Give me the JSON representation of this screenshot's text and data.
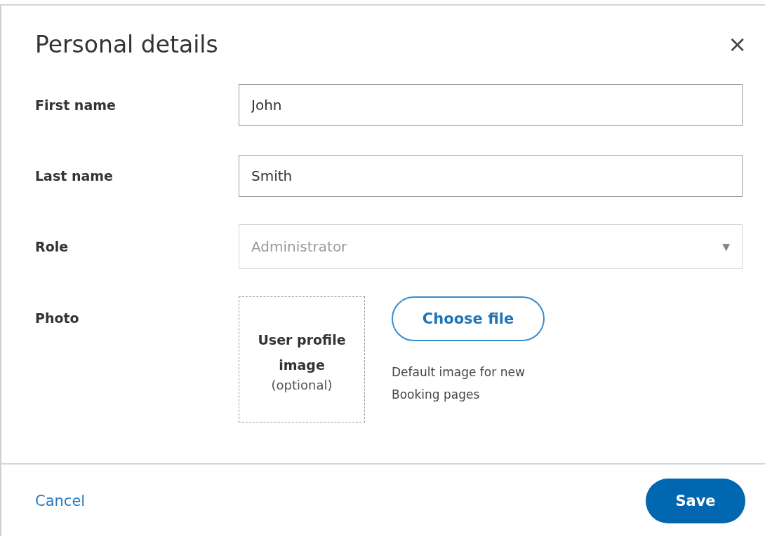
{
  "dialog": {
    "title": "Personal details",
    "close": "×"
  },
  "fields": [
    {
      "kind": "text",
      "label": "First name",
      "value": "John",
      "disabled": false
    },
    {
      "kind": "text",
      "label": "Last name",
      "value": "Smith",
      "disabled": false
    },
    {
      "kind": "select",
      "label": "Role",
      "value": "Administrator",
      "disabled": true,
      "caret": "▼"
    }
  ],
  "photo": {
    "label": "Photo",
    "placeholder_title": "User profile image",
    "placeholder_note": "(optional)",
    "button": "Choose file",
    "hint": "Default image for new Booking pages"
  },
  "footer": {
    "cancel": "Cancel",
    "save": "Save"
  }
}
